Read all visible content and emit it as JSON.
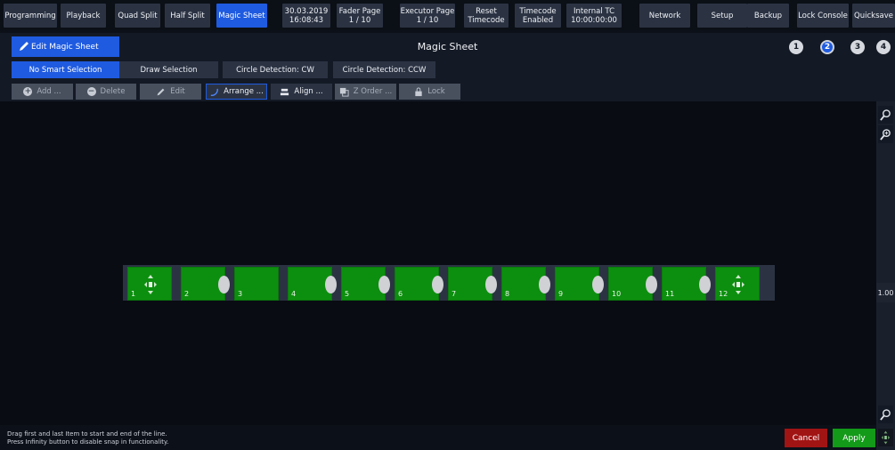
{
  "topbar": {
    "buttons": [
      {
        "label": "Programming"
      },
      {
        "label": "Playback"
      },
      {
        "label": "Quad Split"
      },
      {
        "label": "Half Split"
      },
      {
        "label": "Magic Sheet",
        "active": true
      },
      {
        "line1": "30.03.2019",
        "line2": "16:08:43"
      },
      {
        "line1": "Fader Page",
        "line2": "1 / 10"
      },
      {
        "line1": "Executor Page",
        "line2": "1 / 10"
      },
      {
        "line1": "Reset",
        "line2": "Timecode"
      },
      {
        "line1": "Timecode",
        "line2": "Enabled"
      },
      {
        "line1": "Internal TC",
        "line2": "10:00:00:00"
      },
      {
        "label": "Network"
      },
      {
        "label": "Setup"
      },
      {
        "label": "Backup"
      },
      {
        "label": "Lock Console"
      },
      {
        "label": "Quicksave"
      }
    ]
  },
  "titlebar": {
    "edit_label": "Edit Magic Sheet",
    "title": "Magic Sheet",
    "pages": [
      "1",
      "2",
      "3",
      "4"
    ],
    "active_page": "2"
  },
  "selection": {
    "buttons": [
      "No Smart Selection",
      "Draw Selection",
      "Circle Detection: CW",
      "Circle Detection: CCW"
    ]
  },
  "tools": {
    "add": "Add ...",
    "delete": "Delete",
    "edit": "Edit",
    "arrange": "Arrange ...",
    "align": "Align ...",
    "zorder": "Z Order ...",
    "lock": "Lock"
  },
  "tiles": [
    "1",
    "2",
    "3",
    "4",
    "5",
    "6",
    "7",
    "8",
    "9",
    "10",
    "11",
    "12"
  ],
  "zoom_value": "1.00",
  "hint": {
    "line1": "Drag first and last Item to start and end of the line.",
    "line2": "Press Infinity button to disable snap in functionality."
  },
  "actions": {
    "cancel": "Cancel",
    "apply": "Apply"
  },
  "colors": {
    "accent": "#1f5be0",
    "tile": "#0c8f0e",
    "cancel": "#a11414",
    "apply": "#129a18"
  }
}
